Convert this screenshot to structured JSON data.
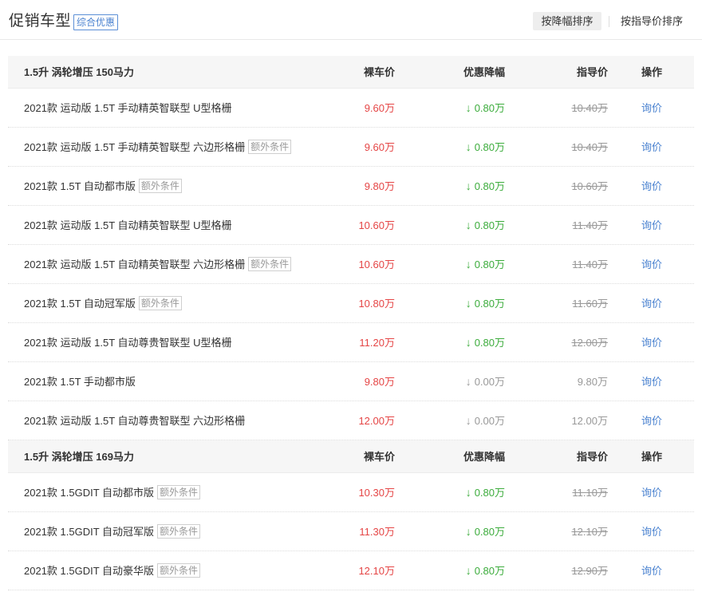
{
  "header": {
    "title": "促销车型",
    "tag": "综合优惠",
    "sort_active": "按降幅排序",
    "sort_other": "按指导价排序"
  },
  "colors": {
    "price": "#e54545",
    "discount_positive": "#3cac3c",
    "discount_zero": "#999999",
    "link": "#4a82d0",
    "group_bg": "#f6f6f6"
  },
  "icons": {
    "down_arrow": "↓"
  },
  "groups": [
    {
      "title": "1.5升 涡轮增压 150马力",
      "columns": {
        "price": "裸车价",
        "discount": "优惠降幅",
        "guide": "指导价",
        "op": "操作"
      },
      "rows": [
        {
          "name": "2021款 运动版 1.5T 手动精英智联型 U型格栅",
          "tag": "",
          "price": "9.60万",
          "discount": "0.80万",
          "guide": "10.40万",
          "op": "询价",
          "discounted": true
        },
        {
          "name": "2021款 运动版 1.5T 手动精英智联型 六边形格栅",
          "tag": "额外条件",
          "price": "9.60万",
          "discount": "0.80万",
          "guide": "10.40万",
          "op": "询价",
          "discounted": true
        },
        {
          "name": "2021款 1.5T 自动都市版",
          "tag": "额外条件",
          "price": "9.80万",
          "discount": "0.80万",
          "guide": "10.60万",
          "op": "询价",
          "discounted": true
        },
        {
          "name": "2021款 运动版 1.5T 自动精英智联型 U型格栅",
          "tag": "",
          "price": "10.60万",
          "discount": "0.80万",
          "guide": "11.40万",
          "op": "询价",
          "discounted": true
        },
        {
          "name": "2021款 运动版 1.5T 自动精英智联型 六边形格栅",
          "tag": "额外条件",
          "price": "10.60万",
          "discount": "0.80万",
          "guide": "11.40万",
          "op": "询价",
          "discounted": true
        },
        {
          "name": "2021款 1.5T 自动冠军版",
          "tag": "额外条件",
          "price": "10.80万",
          "discount": "0.80万",
          "guide": "11.60万",
          "op": "询价",
          "discounted": true
        },
        {
          "name": "2021款 运动版 1.5T 自动尊贵智联型 U型格栅",
          "tag": "",
          "price": "11.20万",
          "discount": "0.80万",
          "guide": "12.00万",
          "op": "询价",
          "discounted": true
        },
        {
          "name": "2021款 1.5T 手动都市版",
          "tag": "",
          "price": "9.80万",
          "discount": "0.00万",
          "guide": "9.80万",
          "op": "询价",
          "discounted": false
        },
        {
          "name": "2021款 运动版 1.5T 自动尊贵智联型 六边形格栅",
          "tag": "",
          "price": "12.00万",
          "discount": "0.00万",
          "guide": "12.00万",
          "op": "询价",
          "discounted": false
        }
      ]
    },
    {
      "title": "1.5升 涡轮增压 169马力",
      "columns": {
        "price": "裸车价",
        "discount": "优惠降幅",
        "guide": "指导价",
        "op": "操作"
      },
      "rows": [
        {
          "name": "2021款 1.5GDIT 自动都市版",
          "tag": "额外条件",
          "price": "10.30万",
          "discount": "0.80万",
          "guide": "11.10万",
          "op": "询价",
          "discounted": true
        },
        {
          "name": "2021款 1.5GDIT 自动冠军版",
          "tag": "额外条件",
          "price": "11.30万",
          "discount": "0.80万",
          "guide": "12.10万",
          "op": "询价",
          "discounted": true
        },
        {
          "name": "2021款 1.5GDIT 自动豪华版",
          "tag": "额外条件",
          "price": "12.10万",
          "discount": "0.80万",
          "guide": "12.90万",
          "op": "询价",
          "discounted": true
        }
      ]
    }
  ]
}
